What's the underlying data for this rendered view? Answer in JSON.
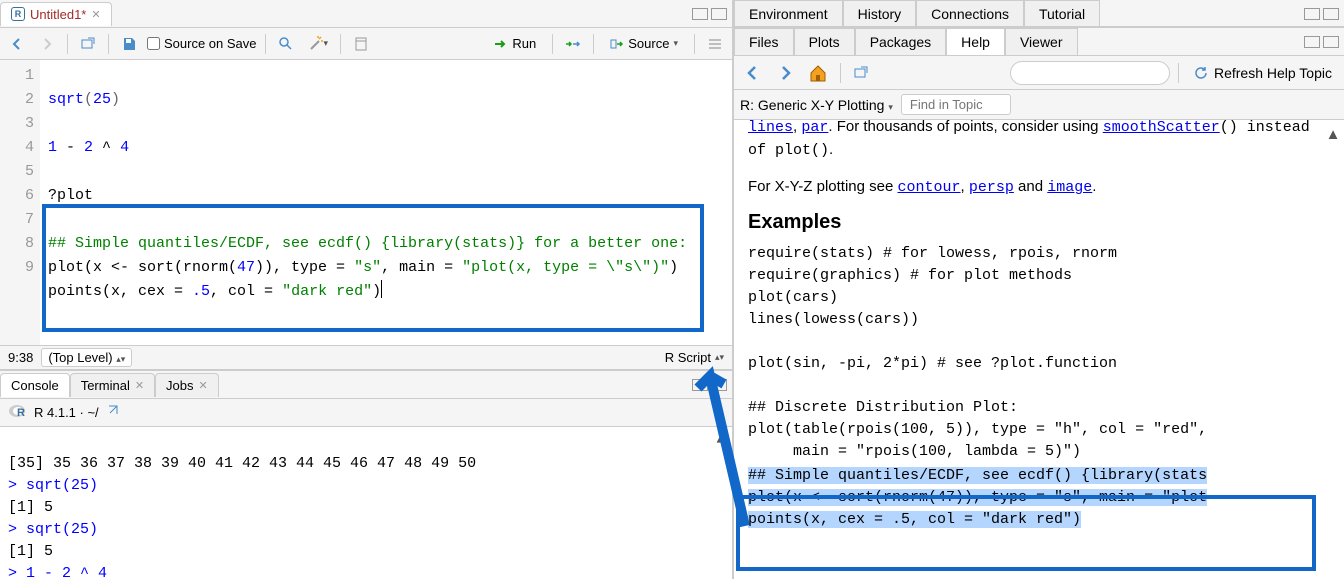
{
  "source": {
    "tab_name": "Untitled1*",
    "source_on_save": "Source on Save",
    "run": "Run",
    "source_btn": "Source",
    "line_numbers": [
      "1",
      "2",
      "3",
      "4",
      "5",
      "6",
      "7",
      " ",
      "8",
      " ",
      "9"
    ],
    "code_lines": {
      "l1_func": "sqrt",
      "l1_paren_open": "(",
      "l1_num": "25",
      "l1_paren_close": ")",
      "l3_num1": "1",
      "l3_op": " - ",
      "l3_num2": "2",
      "l3_pow": " ^ ",
      "l3_num3": "4",
      "l5_q": "?plot",
      "l7_cmt": "## Simple quantiles/ECDF, see ecdf() {library(stats)} for a better one:",
      "l8_a": "plot(x <- sort(rnorm(",
      "l8_n": "47",
      "l8_b": ")), type = ",
      "l8_s1": "\"s\"",
      "l8_c": ", main = ",
      "l8_s2": "\"plot(x, type = \\\"s\\\")\"",
      "l8_d": ")",
      "l9_a": "points(x, cex = ",
      "l9_n": ".5",
      "l9_b": ", col = ",
      "l9_s": "\"dark red\"",
      "l9_c": ")"
    },
    "status_pos": "9:38",
    "top_level": "(Top Level)",
    "r_script": "R Script"
  },
  "console": {
    "tab_console": "Console",
    "tab_terminal": "Terminal",
    "tab_jobs": "Jobs",
    "r_version": "R 4.1.1 · ~/",
    "lines": [
      "[35] 35 36 37 38 39 40 41 42 43 44 45 46 47 48 49 50",
      "> sqrt(25)",
      "[1] 5",
      "> sqrt(25)",
      "[1] 5",
      "> 1 - 2 ^ 4"
    ]
  },
  "env": {
    "tab_env": "Environment",
    "tab_hist": "History",
    "tab_conn": "Connections",
    "tab_tut": "Tutorial"
  },
  "panes": {
    "tab_files": "Files",
    "tab_plots": "Plots",
    "tab_packages": "Packages",
    "tab_help": "Help",
    "tab_viewer": "Viewer",
    "refresh": "Refresh Help Topic",
    "help_title": "R: Generic X-Y Plotting",
    "find_topic": "Find in Topic"
  },
  "help": {
    "partial_line1_a": "lines",
    "partial_line1_b": ", ",
    "partial_line1_c": "par",
    "partial_line1_d": ". For thousands of points, consider using ",
    "smooth": "smoothScatter",
    "instead": "() instead of ",
    "plotfn": "plot()",
    "period": ".",
    "xyz_a": "For X-Y-Z plotting see ",
    "contour": "contour",
    "xyz_b": ", ",
    "persp": "persp",
    "xyz_c": " and ",
    "image": "image",
    "xyz_d": ".",
    "examples": "Examples",
    "code": "require(stats) # for lowess, rpois, rnorm\nrequire(graphics) # for plot methods\nplot(cars)\nlines(lowess(cars))\n\nplot(sin, -pi, 2*pi) # see ?plot.function\n\n## Discrete Distribution Plot:\nplot(table(rpois(100, 5)), type = \"h\", col = \"red\",\n     main = \"rpois(100, lambda = 5)\")\n",
    "sel1": "## Simple quantiles/ECDF, see ecdf() {library(stats",
    "sel2": "plot(x <- sort(rnorm(47)), type = \"s\", main = \"plot",
    "sel3": "points(x, cex = .5, col = \"dark red\")"
  }
}
